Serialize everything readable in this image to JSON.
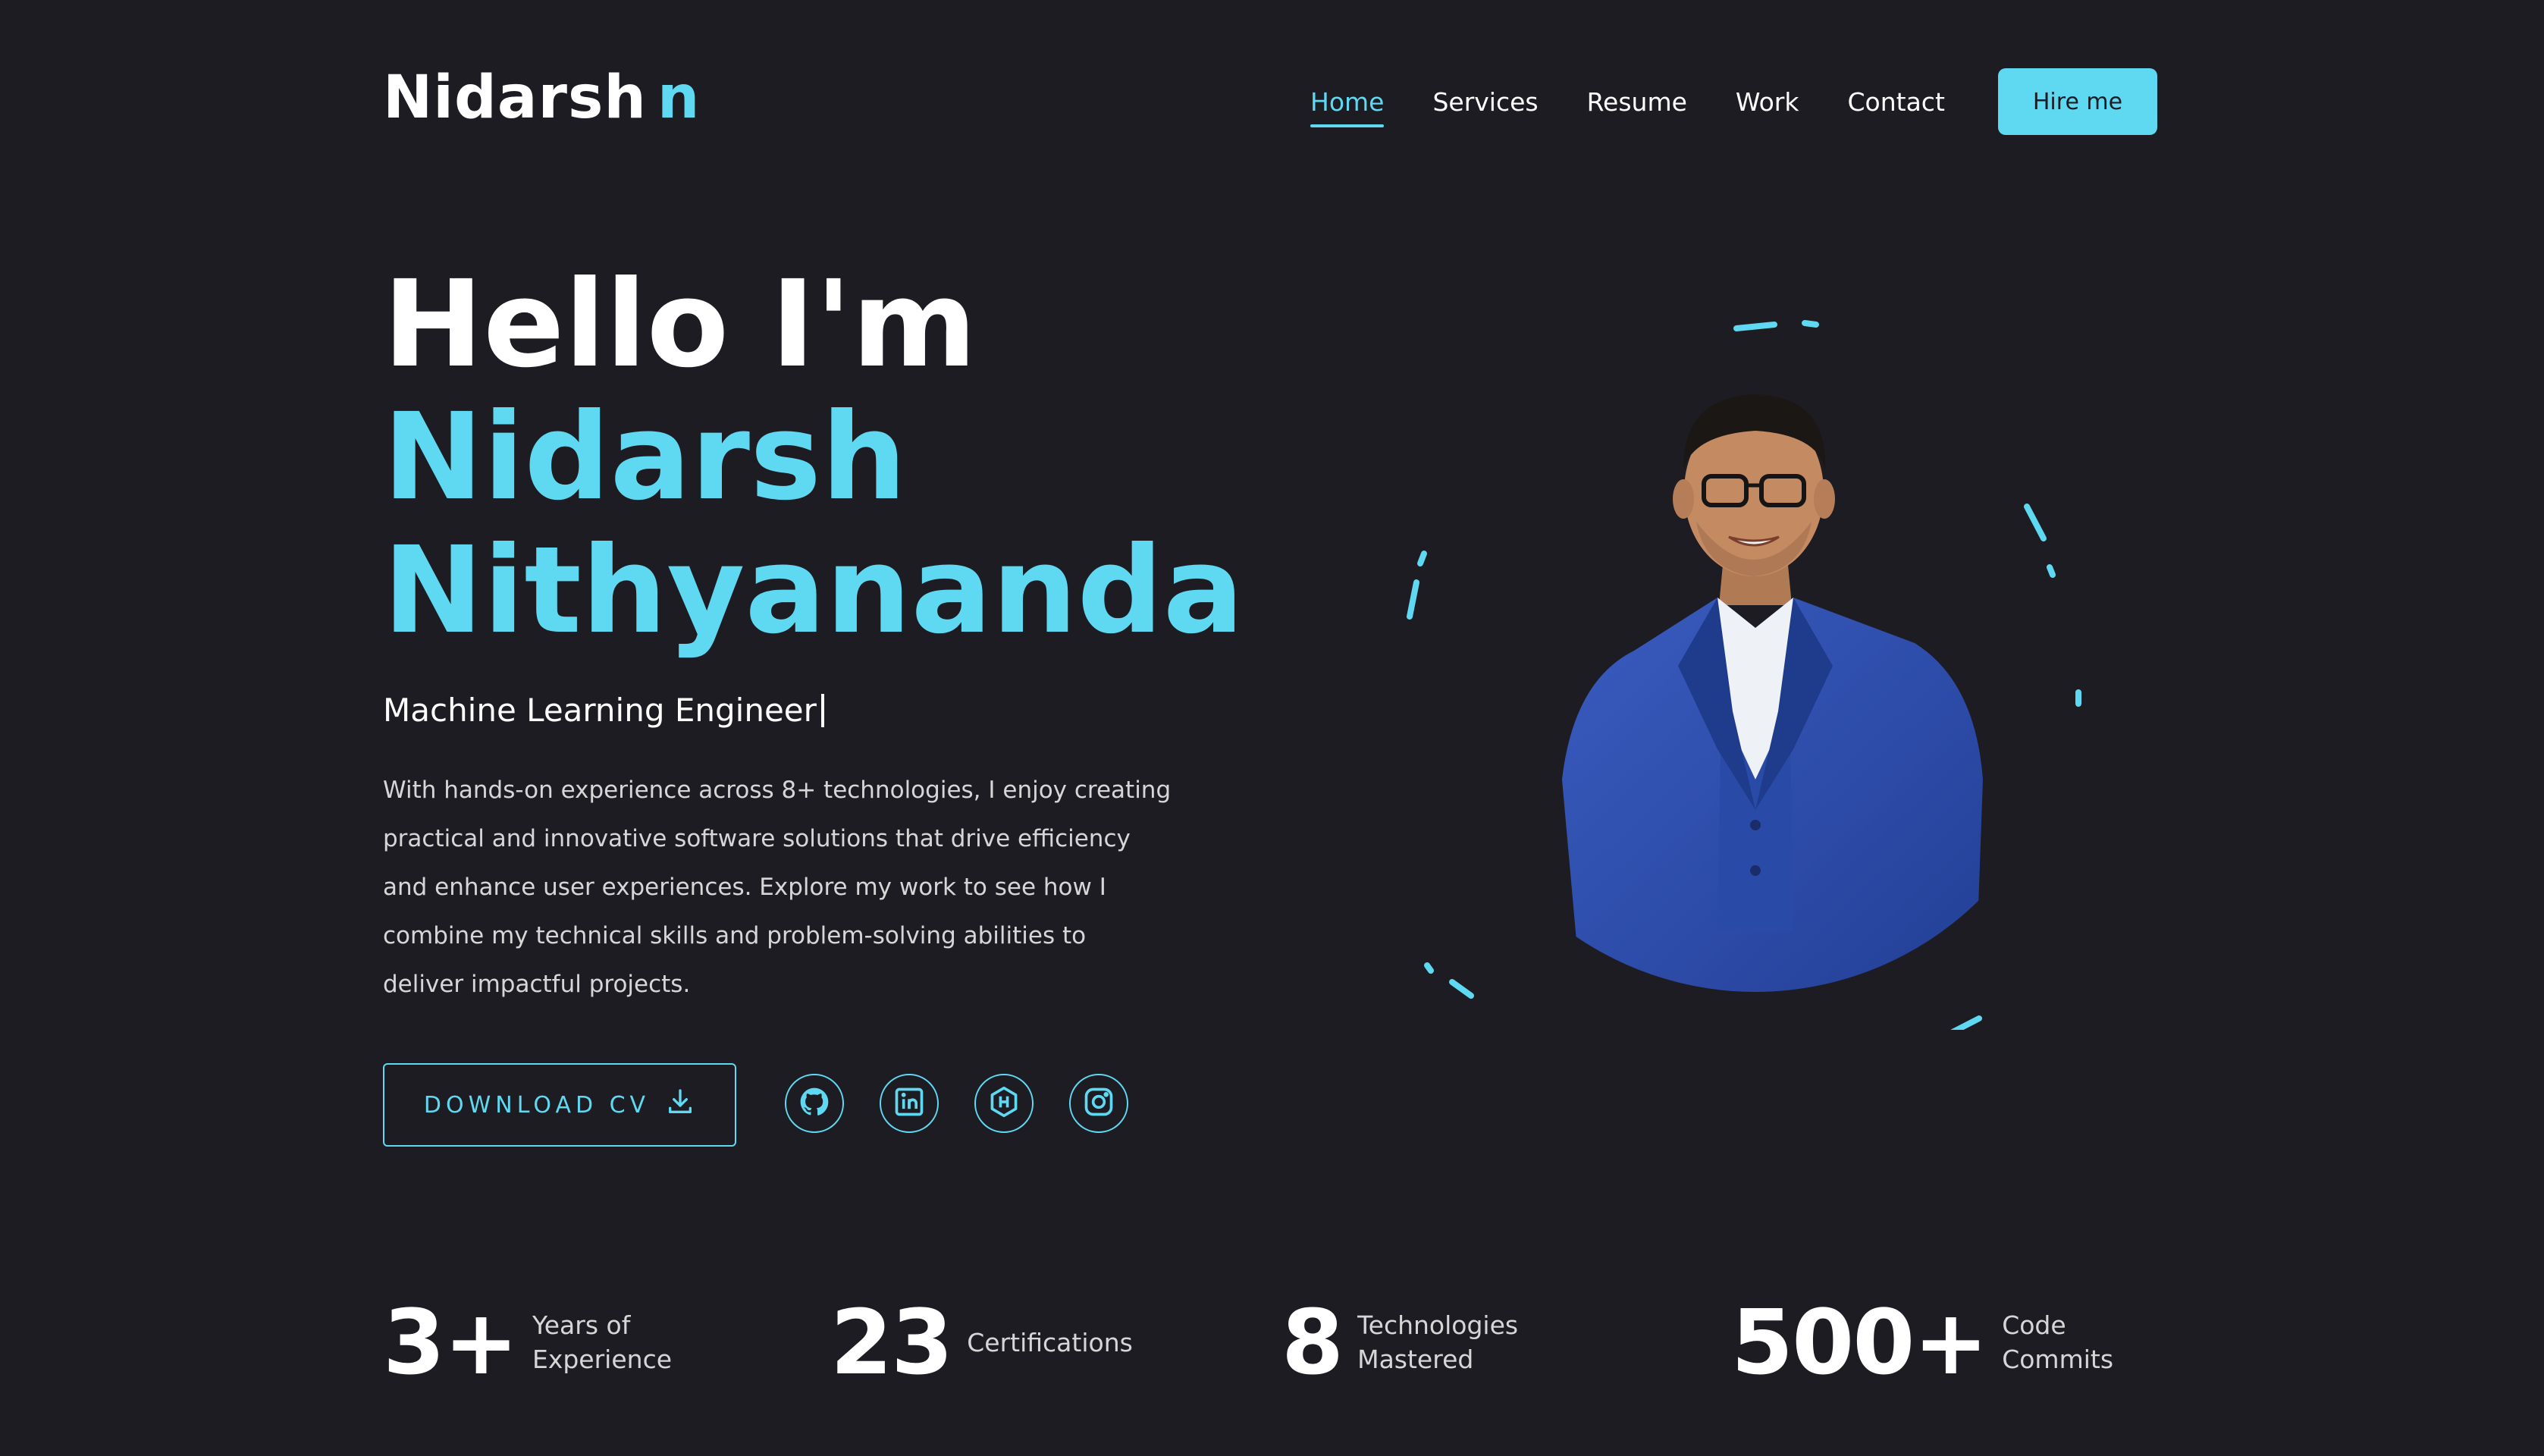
{
  "header": {
    "logo_text": "Nidarsh",
    "logo_accent": "n",
    "nav": [
      {
        "label": "Home",
        "active": true
      },
      {
        "label": "Services",
        "active": false
      },
      {
        "label": "Resume",
        "active": false
      },
      {
        "label": "Work",
        "active": false
      },
      {
        "label": "Contact",
        "active": false
      }
    ],
    "hire_label": "Hire me"
  },
  "hero": {
    "greeting": "Hello I'm",
    "name_first": "Nidarsh",
    "name_last": "Nithyananda",
    "role": "Machine Learning Engineer",
    "bio": "With hands-on experience across 8+ technologies, I enjoy creating practical and innovative software solutions that drive efficiency and enhance user experiences. Explore my work to see how I combine my technical skills and problem-solving abilities to deliver impactful projects.",
    "download_label": "DOWNLOAD CV",
    "socials": [
      "github-icon",
      "linkedin-icon",
      "hashnode-icon",
      "instagram-icon"
    ]
  },
  "stats": [
    {
      "value": "3+",
      "label": "Years of\nExperience"
    },
    {
      "value": "23",
      "label": "Certifications"
    },
    {
      "value": "8",
      "label": "Technologies\nMastered"
    },
    {
      "value": "500+",
      "label": "Code\nCommits"
    }
  ],
  "colors": {
    "background": "#1c1c22",
    "accent": "#5fd9f2",
    "text": "#ffffff",
    "suit": "#2f4ea8"
  }
}
